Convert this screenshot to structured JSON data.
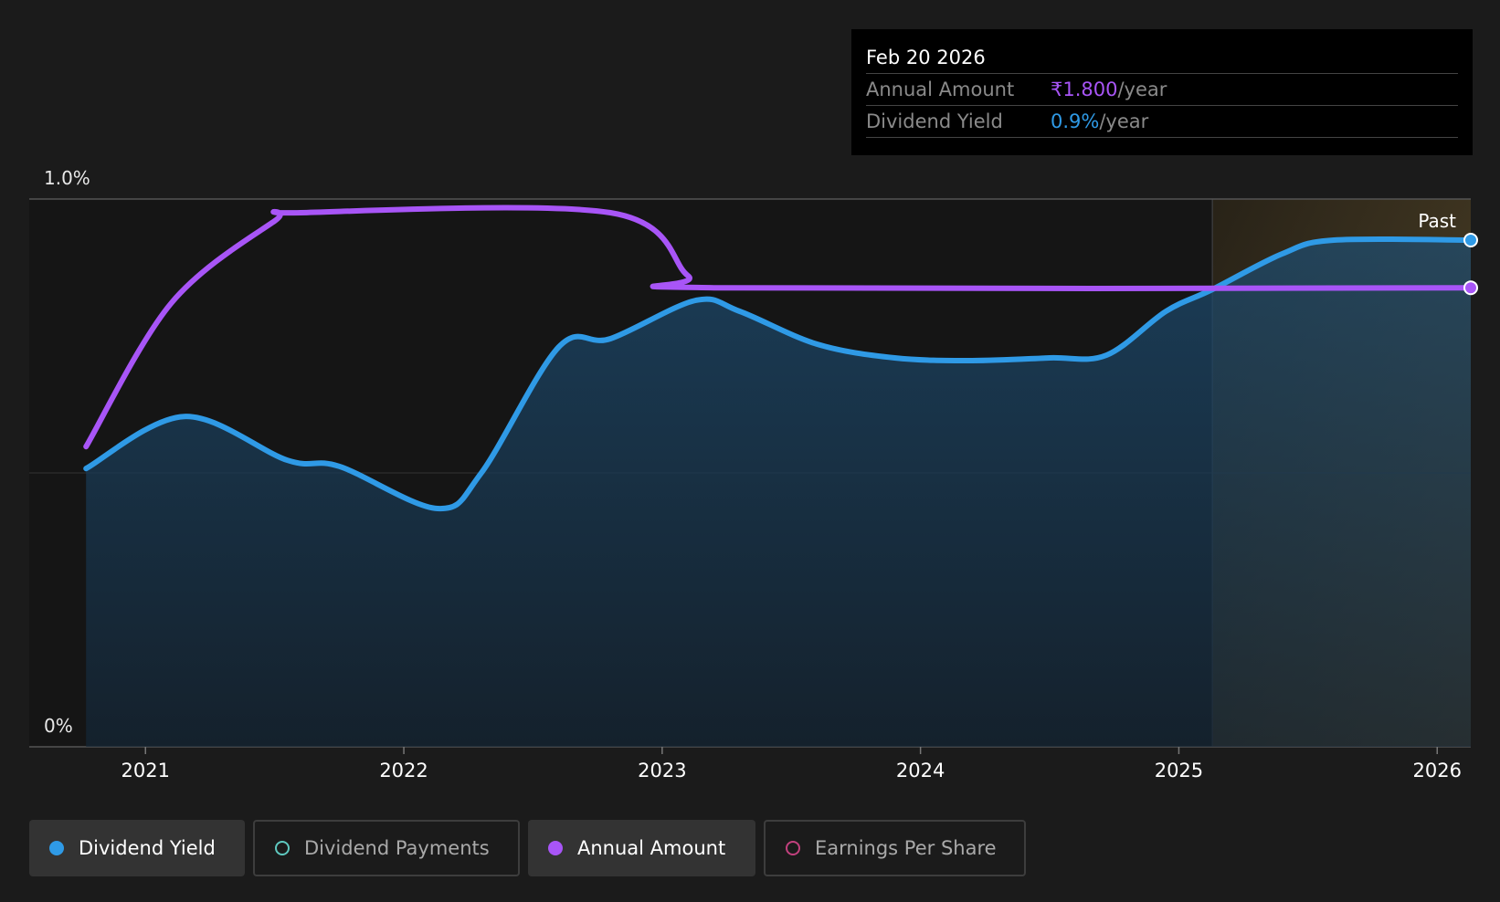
{
  "tooltip": {
    "date": "Feb 20 2026",
    "rows": [
      {
        "label": "Annual Amount",
        "value": "₹1.800",
        "unit": "/year"
      },
      {
        "label": "Dividend Yield",
        "value": "0.9%",
        "unit": "/year"
      }
    ]
  },
  "legend": [
    {
      "label": "Dividend Yield",
      "active": true,
      "color": "#2f9ae6"
    },
    {
      "label": "Dividend Payments",
      "active": false,
      "color": "#5fc9c0"
    },
    {
      "label": "Annual Amount",
      "active": true,
      "color": "#a855f7"
    },
    {
      "label": "Earnings Per Share",
      "active": false,
      "color": "#c2417e"
    }
  ],
  "colors": {
    "background": "#1b1b1b",
    "yield": "#2f9ae6",
    "annual_amount": "#a855f7",
    "past_highlight": "#4a3f28"
  },
  "chart_data": {
    "type": "line",
    "y_axis_labels": [
      "1.0%",
      "0%"
    ],
    "ylim": [
      0,
      1.0
    ],
    "xlim": [
      2020.55,
      2026.13
    ],
    "x_tick_labels": [
      "2021",
      "2022",
      "2023",
      "2024",
      "2025",
      "2026"
    ],
    "x_ticks": [
      2021,
      2022,
      2023,
      2024,
      2025,
      2026
    ],
    "gridlines": [
      0,
      0.5,
      1.0
    ],
    "past_region": {
      "label": "Past",
      "start": 2025.13,
      "end": 2026.13
    },
    "series": [
      {
        "name": "Dividend Yield",
        "area": true,
        "points": [
          [
            2020.77,
            0.508
          ],
          [
            2021.15,
            0.603
          ],
          [
            2021.55,
            0.523
          ],
          [
            2021.75,
            0.512
          ],
          [
            2022.13,
            0.435
          ],
          [
            2022.3,
            0.5
          ],
          [
            2022.6,
            0.73
          ],
          [
            2022.8,
            0.745
          ],
          [
            2023.13,
            0.815
          ],
          [
            2023.3,
            0.795
          ],
          [
            2023.6,
            0.735
          ],
          [
            2023.9,
            0.71
          ],
          [
            2024.2,
            0.705
          ],
          [
            2024.5,
            0.71
          ],
          [
            2024.72,
            0.715
          ],
          [
            2024.95,
            0.795
          ],
          [
            2025.13,
            0.835
          ],
          [
            2025.4,
            0.9
          ],
          [
            2025.6,
            0.925
          ],
          [
            2026.13,
            0.925
          ]
        ]
      },
      {
        "name": "Annual Amount",
        "area": false,
        "points": [
          [
            2020.77,
            0.548
          ],
          [
            2021.1,
            0.81
          ],
          [
            2021.5,
            0.96
          ],
          [
            2021.6,
            0.975
          ],
          [
            2022.8,
            0.975
          ],
          [
            2023.1,
            0.86
          ],
          [
            2023.2,
            0.838
          ],
          [
            2026.13,
            0.838
          ]
        ]
      }
    ]
  }
}
